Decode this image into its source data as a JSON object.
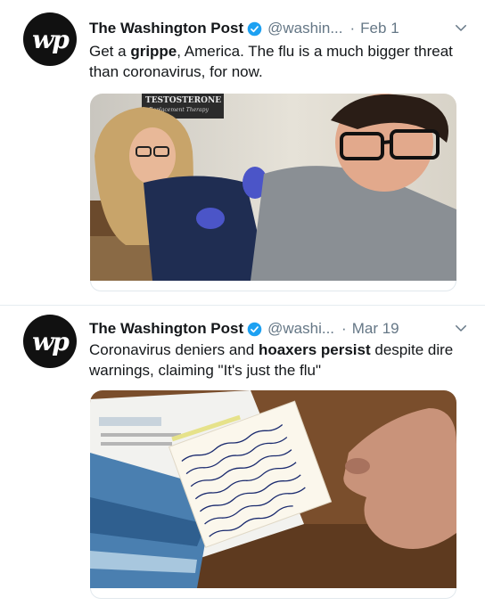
{
  "tweets": [
    {
      "avatar_text": "wp",
      "name": "The Washington Post",
      "handle": "@washin...",
      "dot": "·",
      "date": "Feb 1",
      "text_parts": [
        "Get a ",
        "grippe",
        ", America. The flu is a much bigger threat than coronavirus, for now."
      ],
      "photo": {
        "sign_title": "TESTOSTERONE",
        "sign_sub": "Replacement Therapy"
      }
    },
    {
      "avatar_text": "wp",
      "name": "The Washington Post",
      "handle": "@washi...",
      "dot": "·",
      "date": "Mar 19",
      "text_parts": [
        "Coronavirus deniers and ",
        "hoaxers persist",
        " despite dire warnings, claiming \"It's just the flu\""
      ],
      "photo": {
        "note_text": "Not once in the Bible does it say... wash your hands... fear C-O-V-I-D-19 ... Christ ... Commands ... Psalm 119"
      }
    }
  ],
  "colors": {
    "verified": "#1da1f2",
    "secondary_text": "#657786",
    "avatar_bg": "#111111"
  },
  "icons": [
    "verified-badge-icon",
    "chevron-down-icon"
  ]
}
